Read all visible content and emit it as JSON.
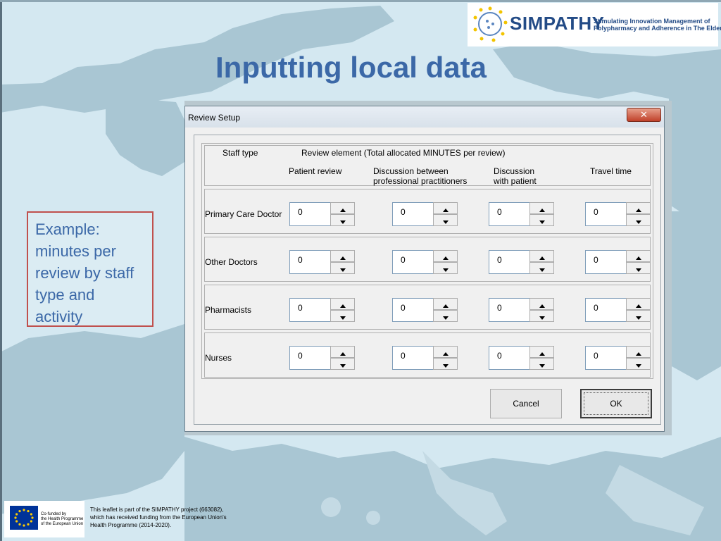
{
  "logo": {
    "wordmark": "SIMPATHY",
    "tagline_line1": "Stimulating Innovation Management of",
    "tagline_line2": "Polypharmacy and Adherence in The Elderly"
  },
  "slide": {
    "title": "Inputting local data"
  },
  "callout": {
    "lines": [
      "Example:",
      "minutes per",
      "review by staff",
      "type and",
      "activity"
    ]
  },
  "dialog": {
    "title": "Review Setup",
    "close_glyph": "✕",
    "header": {
      "staff_type": "Staff type",
      "review_element": "Review element (Total allocated MINUTES per review)",
      "col1": [
        "Patient review"
      ],
      "col2": [
        "Discussion between",
        "professional practitioners"
      ],
      "col3": [
        "Discussion",
        "with patient"
      ],
      "col4": [
        "Travel time"
      ]
    },
    "rows": [
      {
        "label": "Primary Care Doctor",
        "values": [
          "0",
          "0",
          "0",
          "0"
        ]
      },
      {
        "label": "Other Doctors",
        "values": [
          "0",
          "0",
          "0",
          "0"
        ]
      },
      {
        "label": "Pharmacists",
        "values": [
          "0",
          "0",
          "0",
          "0"
        ]
      },
      {
        "label": "Nurses",
        "values": [
          "0",
          "0",
          "0",
          "0"
        ]
      }
    ],
    "buttons": {
      "cancel": "Cancel",
      "ok": "OK"
    }
  },
  "footer": {
    "eu_line1": "Co-funded by",
    "eu_line2": "the Health Programme",
    "eu_line3": "of the European Union",
    "text_line1": "This leaflet is part of the SIMPATHY project (663082),",
    "text_line2": "which has received funding from the European Union's",
    "text_line3": "Health Programme (2014-2020)."
  },
  "colors": {
    "title": "#3b68a7",
    "callout_border": "#c0504d",
    "brand": "#234b86",
    "sea": "#d4e8f1",
    "land": "#a9c6d3"
  }
}
